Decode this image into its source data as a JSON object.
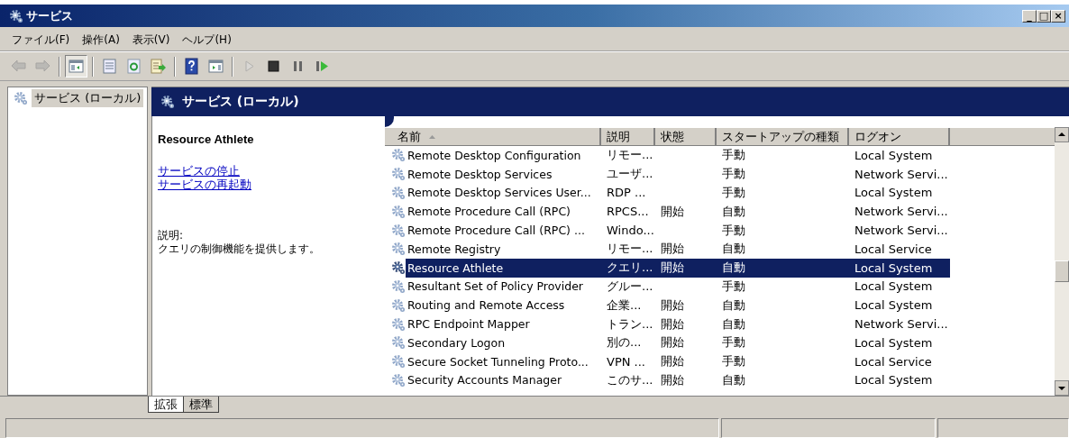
{
  "window": {
    "title": "サービス",
    "controls": [
      "_",
      "□",
      "×"
    ]
  },
  "menu": [
    "ファイル(F)",
    "操作(A)",
    "表示(V)",
    "ヘルプ(H)"
  ],
  "toolbar": [
    {
      "kind": "back",
      "disabled": true
    },
    {
      "kind": "forward",
      "disabled": true
    },
    {
      "kind": "sep"
    },
    {
      "kind": "tree",
      "pressed": true
    },
    {
      "kind": "sep"
    },
    {
      "kind": "properties"
    },
    {
      "kind": "refresh"
    },
    {
      "kind": "export"
    },
    {
      "kind": "sep"
    },
    {
      "kind": "help"
    },
    {
      "kind": "actionpane"
    },
    {
      "kind": "sep"
    },
    {
      "kind": "play",
      "disabled": true
    },
    {
      "kind": "stop"
    },
    {
      "kind": "pause"
    },
    {
      "kind": "resume"
    }
  ],
  "tree": [
    {
      "label": "サービス (ローカル)",
      "selected": true
    }
  ],
  "pane_title": "サービス (ローカル)",
  "detail": {
    "title": "Resource Athlete",
    "links": [
      "サービスの停止",
      "サービスの再起動"
    ],
    "description_label": "説明:",
    "description": "クエリの制御機能を提供します。"
  },
  "table": {
    "columns": [
      {
        "label": "名前",
        "sorted": true
      },
      {
        "label": "説明"
      },
      {
        "label": "状態"
      },
      {
        "label": "スタートアップの種類"
      },
      {
        "label": "ログオン"
      }
    ],
    "rows": [
      {
        "cells": [
          "Remote Desktop Configuration",
          "リモー...",
          "",
          "手動",
          "Local System"
        ],
        "selected": false
      },
      {
        "cells": [
          "Remote Desktop Services",
          "ユーザ...",
          "",
          "手動",
          "Network Servi..."
        ],
        "selected": false
      },
      {
        "cells": [
          "Remote Desktop Services User...",
          "RDP ...",
          "",
          "手動",
          "Local System"
        ],
        "selected": false
      },
      {
        "cells": [
          "Remote Procedure Call (RPC)",
          "RPCS...",
          "開始",
          "自動",
          "Network Servi..."
        ],
        "selected": false
      },
      {
        "cells": [
          "Remote Procedure Call (RPC) ...",
          "Windo...",
          "",
          "手動",
          "Network Servi..."
        ],
        "selected": false
      },
      {
        "cells": [
          "Remote Registry",
          "リモー...",
          "開始",
          "自動",
          "Local Service"
        ],
        "selected": false
      },
      {
        "cells": [
          "Resource Athlete",
          "クエリ...",
          "開始",
          "自動",
          "Local System"
        ],
        "selected": true
      },
      {
        "cells": [
          "Resultant Set of Policy Provider",
          "グルー...",
          "",
          "手動",
          "Local System"
        ],
        "selected": false
      },
      {
        "cells": [
          "Routing and Remote Access",
          "企業...",
          "開始",
          "自動",
          "Local System"
        ],
        "selected": false
      },
      {
        "cells": [
          "RPC Endpoint Mapper",
          "トラン...",
          "開始",
          "自動",
          "Network Servi..."
        ],
        "selected": false
      },
      {
        "cells": [
          "Secondary Logon",
          "別の...",
          "開始",
          "手動",
          "Local System"
        ],
        "selected": false
      },
      {
        "cells": [
          "Secure Socket Tunneling Proto...",
          "VPN ...",
          "開始",
          "手動",
          "Local Service"
        ],
        "selected": false
      },
      {
        "cells": [
          "Security Accounts Manager",
          "このサ...",
          "開始",
          "自動",
          "Local System"
        ],
        "selected": false
      }
    ]
  },
  "tabs": [
    {
      "label": "拡張",
      "selected": true
    },
    {
      "label": "標準",
      "selected": false
    }
  ]
}
